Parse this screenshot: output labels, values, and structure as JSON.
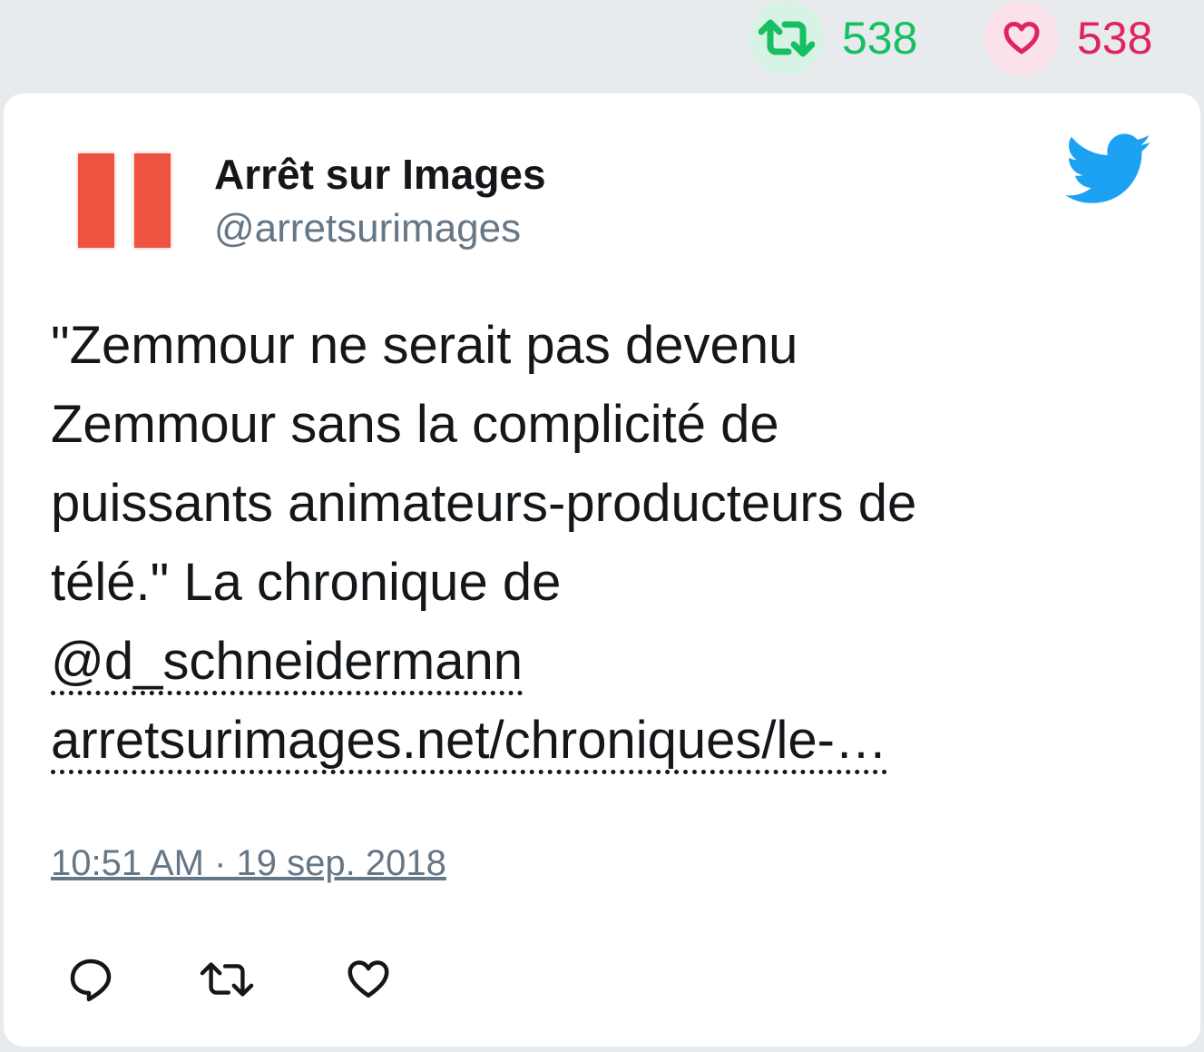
{
  "stats": {
    "retweet_count": "538",
    "like_count": "538",
    "retweet_icon": "retweet-icon",
    "like_icon": "heart-icon",
    "retweet_color": "#17bf63",
    "like_color": "#e0245e"
  },
  "tweet": {
    "author_name": "Arrêt sur Images",
    "author_handle": "@arretsurimages",
    "text_lines": [
      "\"Zemmour ne serait pas devenu",
      "Zemmour sans la complicité de",
      "puissants animateurs-producteurs de",
      "télé.\" La chronique de"
    ],
    "mention": "@d_schneidermann",
    "url": "arretsurimages.net/chroniques/le-…",
    "timestamp": "10:51 AM · 19 sep. 2018",
    "brand_icon": "twitter-bird-icon",
    "brand_color": "#1da1f2",
    "avatar_color": "#ee5342"
  },
  "actions": {
    "reply_icon": "reply-icon",
    "retweet_icon": "retweet-icon",
    "like_icon": "heart-icon"
  }
}
